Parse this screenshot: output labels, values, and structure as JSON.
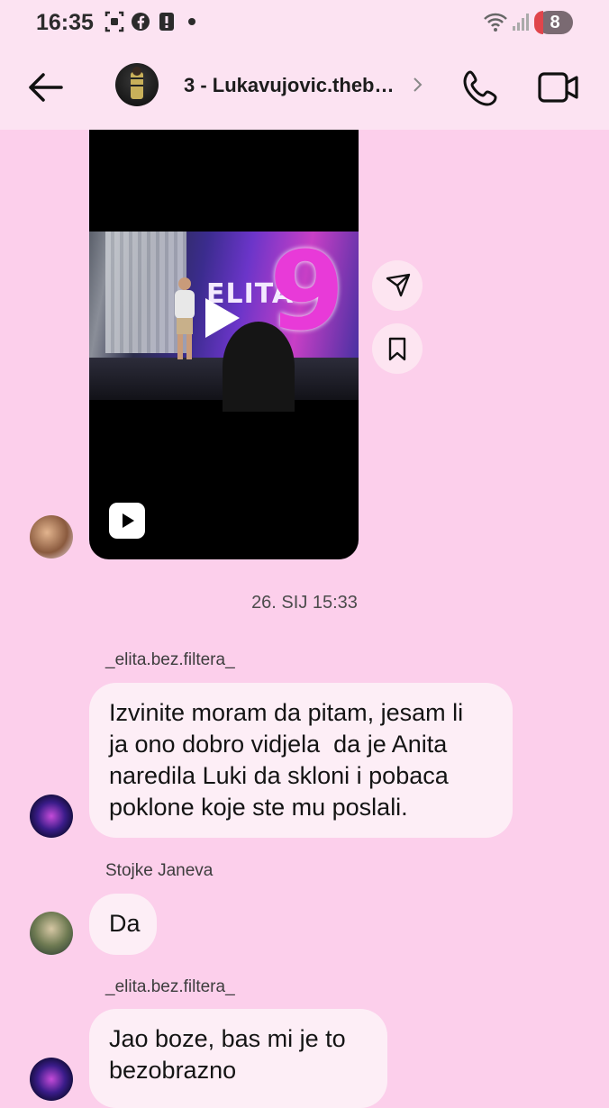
{
  "status_bar": {
    "time": "16:35",
    "battery": "8"
  },
  "header": {
    "title": "3 - Lukavujovic.theb…"
  },
  "messages": {
    "timestamp": "26. SIJ 15:33",
    "m1": {
      "sender": "_elita.bez.filtera_",
      "lines": [
        "Izvinite moram da pitam, jesam li",
        "ja ono dobro vidjela  da je Anita",
        "naredila Luki da skloni i pobaca",
        "poklone koje ste mu poslali."
      ]
    },
    "m2": {
      "sender": "Stojke Janeva",
      "lines": [
        "Da"
      ]
    },
    "m3": {
      "sender": "_elita.bez.filtera_",
      "lines": [
        "Jao boze, bas mi je to",
        "bezobrazno"
      ]
    }
  },
  "video": {
    "thumb_text": "ELITA",
    "thumb_number": "9"
  },
  "colors": {
    "background": "#fccfeb",
    "header": "#fce3f2",
    "bubble": "#fdeef6"
  }
}
